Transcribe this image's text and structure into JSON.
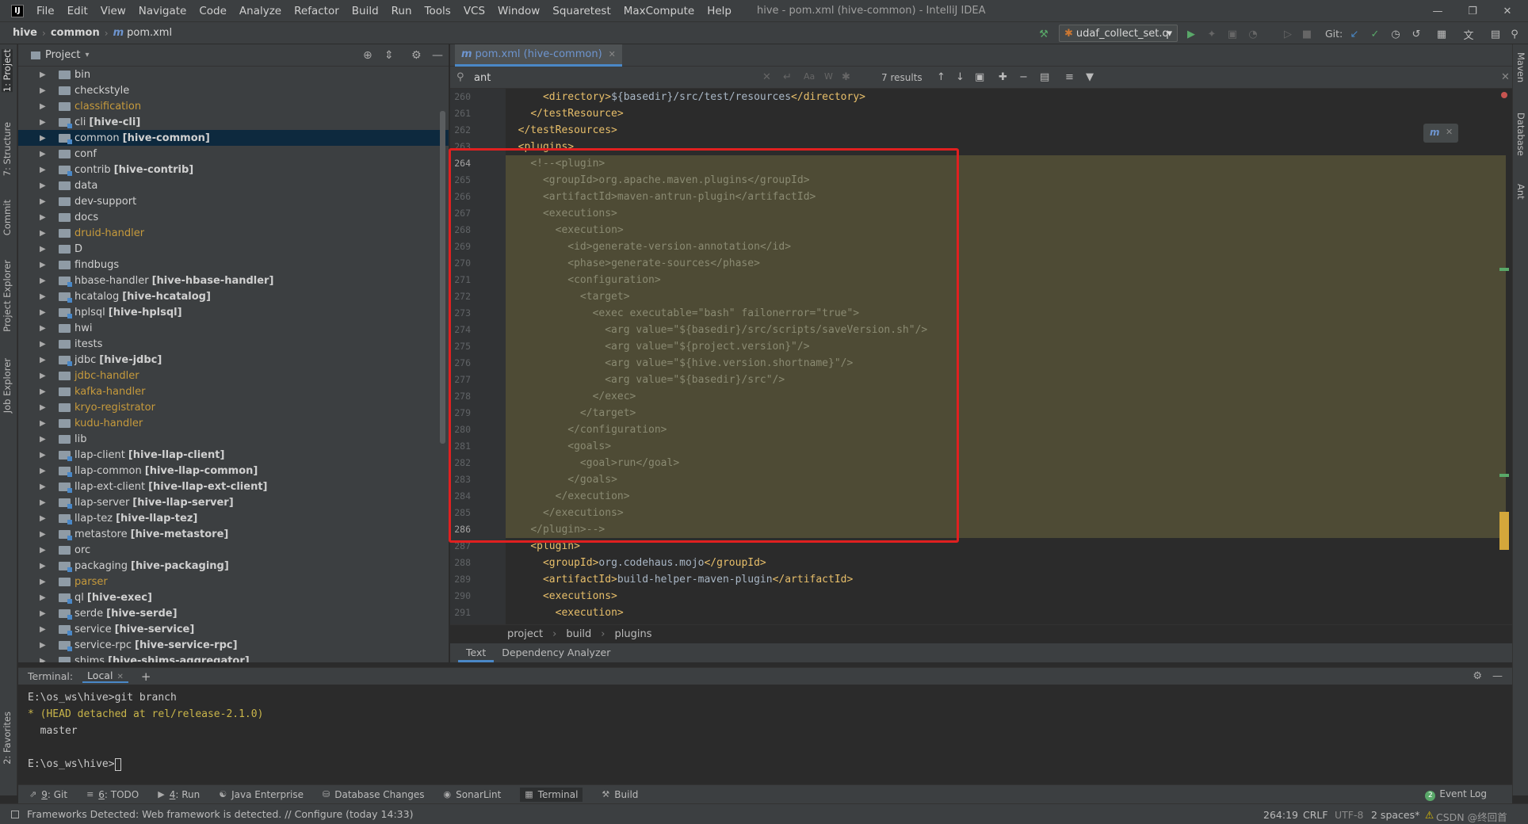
{
  "app": {
    "window_title": "hive - pom.xml (hive-common) - IntelliJ IDEA",
    "logo": "IJ",
    "menu": [
      "File",
      "Edit",
      "View",
      "Navigate",
      "Code",
      "Analyze",
      "Refactor",
      "Build",
      "Run",
      "Tools",
      "VCS",
      "Window",
      "Squaretest",
      "MaxCompute",
      "Help"
    ]
  },
  "navbar": {
    "crumbs": [
      "hive",
      "common",
      "pom.xml"
    ],
    "run_config": "udaf_collect_set.q",
    "git_label": "Git:"
  },
  "project_panel": {
    "title": "Project",
    "items": [
      {
        "name": "bin",
        "module": "",
        "style": "normal"
      },
      {
        "name": "checkstyle",
        "module": "",
        "style": "normal"
      },
      {
        "name": "classification",
        "module": "",
        "style": "orange"
      },
      {
        "name": "cli",
        "module": "[hive-cli]",
        "style": "normal"
      },
      {
        "name": "common",
        "module": "[hive-common]",
        "style": "selected"
      },
      {
        "name": "conf",
        "module": "",
        "style": "normal"
      },
      {
        "name": "contrib",
        "module": "[hive-contrib]",
        "style": "normal"
      },
      {
        "name": "data",
        "module": "",
        "style": "normal"
      },
      {
        "name": "dev-support",
        "module": "",
        "style": "normal"
      },
      {
        "name": "docs",
        "module": "",
        "style": "normal"
      },
      {
        "name": "druid-handler",
        "module": "",
        "style": "orange"
      },
      {
        "name": "D",
        "module": "",
        "style": "normal"
      },
      {
        "name": "findbugs",
        "module": "",
        "style": "normal"
      },
      {
        "name": "hbase-handler",
        "module": "[hive-hbase-handler]",
        "style": "normal"
      },
      {
        "name": "hcatalog",
        "module": "[hive-hcatalog]",
        "style": "normal"
      },
      {
        "name": "hplsql",
        "module": "[hive-hplsql]",
        "style": "normal"
      },
      {
        "name": "hwi",
        "module": "",
        "style": "normal"
      },
      {
        "name": "itests",
        "module": "",
        "style": "normal"
      },
      {
        "name": "jdbc",
        "module": "[hive-jdbc]",
        "style": "normal"
      },
      {
        "name": "jdbc-handler",
        "module": "",
        "style": "orange"
      },
      {
        "name": "kafka-handler",
        "module": "",
        "style": "orange"
      },
      {
        "name": "kryo-registrator",
        "module": "",
        "style": "orange"
      },
      {
        "name": "kudu-handler",
        "module": "",
        "style": "orange"
      },
      {
        "name": "lib",
        "module": "",
        "style": "normal"
      },
      {
        "name": "llap-client",
        "module": "[hive-llap-client]",
        "style": "normal"
      },
      {
        "name": "llap-common",
        "module": "[hive-llap-common]",
        "style": "normal"
      },
      {
        "name": "llap-ext-client",
        "module": "[hive-llap-ext-client]",
        "style": "normal"
      },
      {
        "name": "llap-server",
        "module": "[hive-llap-server]",
        "style": "normal"
      },
      {
        "name": "llap-tez",
        "module": "[hive-llap-tez]",
        "style": "normal"
      },
      {
        "name": "metastore",
        "module": "[hive-metastore]",
        "style": "normal"
      },
      {
        "name": "orc",
        "module": "",
        "style": "normal"
      },
      {
        "name": "packaging",
        "module": "[hive-packaging]",
        "style": "normal"
      },
      {
        "name": "parser",
        "module": "",
        "style": "orange"
      },
      {
        "name": "ql",
        "module": "[hive-exec]",
        "style": "normal"
      },
      {
        "name": "serde",
        "module": "[hive-serde]",
        "style": "normal"
      },
      {
        "name": "service",
        "module": "[hive-service]",
        "style": "normal"
      },
      {
        "name": "service-rpc",
        "module": "[hive-service-rpc]",
        "style": "normal"
      },
      {
        "name": "shims",
        "module": "[hive-shims-aggregator]",
        "style": "normal"
      }
    ]
  },
  "editor": {
    "tab_label": "pom.xml (hive-common)",
    "search_value": "ant",
    "search_results": "7 results",
    "lines": [
      {
        "n": "260",
        "hl": false,
        "indent": "      ",
        "parts": [
          [
            "tag",
            "<directory>"
          ],
          [
            "txt",
            "${basedir}/src/test/resources"
          ],
          [
            "tag",
            "</directory>"
          ]
        ]
      },
      {
        "n": "261",
        "hl": false,
        "indent": "    ",
        "parts": [
          [
            "tag",
            "</testResource>"
          ]
        ]
      },
      {
        "n": "262",
        "hl": false,
        "indent": "  ",
        "parts": [
          [
            "tag",
            "</testResources>"
          ]
        ]
      },
      {
        "n": "263",
        "hl": false,
        "indent": "  ",
        "parts": [
          [
            "tag",
            "<plugins>"
          ]
        ]
      },
      {
        "n": "264",
        "hl": true,
        "indent": "    ",
        "parts": [
          [
            "cmt",
            "<!--<plugin>"
          ]
        ]
      },
      {
        "n": "265",
        "hl": true,
        "indent": "      ",
        "parts": [
          [
            "cmt",
            "<groupId>org.apache.maven.plugins</groupId>"
          ]
        ]
      },
      {
        "n": "266",
        "hl": true,
        "indent": "      ",
        "parts": [
          [
            "cmt",
            "<artifactId>maven-antrun-plugin</artifactId>"
          ]
        ]
      },
      {
        "n": "267",
        "hl": true,
        "indent": "      ",
        "parts": [
          [
            "cmt",
            "<executions>"
          ]
        ]
      },
      {
        "n": "268",
        "hl": true,
        "indent": "        ",
        "parts": [
          [
            "cmt",
            "<execution>"
          ]
        ]
      },
      {
        "n": "269",
        "hl": true,
        "indent": "          ",
        "parts": [
          [
            "cmt",
            "<id>generate-version-annotation</id>"
          ]
        ]
      },
      {
        "n": "270",
        "hl": true,
        "indent": "          ",
        "parts": [
          [
            "cmt",
            "<phase>generate-sources</phase>"
          ]
        ]
      },
      {
        "n": "271",
        "hl": true,
        "indent": "          ",
        "parts": [
          [
            "cmt",
            "<configuration>"
          ]
        ]
      },
      {
        "n": "272",
        "hl": true,
        "indent": "            ",
        "parts": [
          [
            "cmt",
            "<target>"
          ]
        ]
      },
      {
        "n": "273",
        "hl": true,
        "indent": "              ",
        "parts": [
          [
            "cmt",
            "<exec executable=\"bash\" failonerror=\"true\">"
          ]
        ]
      },
      {
        "n": "274",
        "hl": true,
        "indent": "                ",
        "parts": [
          [
            "cmt",
            "<arg value=\"${basedir}/src/scripts/saveVersion.sh\"/>"
          ]
        ]
      },
      {
        "n": "275",
        "hl": true,
        "indent": "                ",
        "parts": [
          [
            "cmt",
            "<arg value=\"${project.version}\"/>"
          ]
        ]
      },
      {
        "n": "276",
        "hl": true,
        "indent": "                ",
        "parts": [
          [
            "cmt",
            "<arg value=\"${hive.version.shortname}\"/>"
          ]
        ]
      },
      {
        "n": "277",
        "hl": true,
        "indent": "                ",
        "parts": [
          [
            "cmt",
            "<arg value=\"${basedir}/src\"/>"
          ]
        ]
      },
      {
        "n": "278",
        "hl": true,
        "indent": "              ",
        "parts": [
          [
            "cmt",
            "</exec>"
          ]
        ]
      },
      {
        "n": "279",
        "hl": true,
        "indent": "            ",
        "parts": [
          [
            "cmt",
            "</target>"
          ]
        ]
      },
      {
        "n": "280",
        "hl": true,
        "indent": "          ",
        "parts": [
          [
            "cmt",
            "</configuration>"
          ]
        ]
      },
      {
        "n": "281",
        "hl": true,
        "indent": "          ",
        "parts": [
          [
            "cmt",
            "<goals>"
          ]
        ]
      },
      {
        "n": "282",
        "hl": true,
        "indent": "            ",
        "parts": [
          [
            "cmt",
            "<goal>run</goal>"
          ]
        ]
      },
      {
        "n": "283",
        "hl": true,
        "indent": "          ",
        "parts": [
          [
            "cmt",
            "</goals>"
          ]
        ]
      },
      {
        "n": "284",
        "hl": true,
        "indent": "        ",
        "parts": [
          [
            "cmt",
            "</execution>"
          ]
        ]
      },
      {
        "n": "285",
        "hl": true,
        "indent": "      ",
        "parts": [
          [
            "cmt",
            "</executions>"
          ]
        ]
      },
      {
        "n": "286",
        "hl": true,
        "indent": "    ",
        "parts": [
          [
            "cmt",
            "</plugin>-->"
          ]
        ]
      },
      {
        "n": "287",
        "hl": false,
        "indent": "    ",
        "parts": [
          [
            "tag",
            "<plugin>"
          ]
        ]
      },
      {
        "n": "288",
        "hl": false,
        "indent": "      ",
        "parts": [
          [
            "tag",
            "<groupId>"
          ],
          [
            "txt",
            "org.codehaus.mojo"
          ],
          [
            "tag",
            "</groupId>"
          ]
        ]
      },
      {
        "n": "289",
        "hl": false,
        "indent": "      ",
        "parts": [
          [
            "tag",
            "<artifactId>"
          ],
          [
            "txt",
            "build-helper-maven-plugin"
          ],
          [
            "tag",
            "</artifactId>"
          ]
        ]
      },
      {
        "n": "290",
        "hl": false,
        "indent": "      ",
        "parts": [
          [
            "tag",
            "<executions>"
          ]
        ]
      },
      {
        "n": "291",
        "hl": false,
        "indent": "        ",
        "parts": [
          [
            "tag",
            "<execution>"
          ]
        ]
      }
    ],
    "breadcrumbs": [
      "project",
      "build",
      "plugins"
    ],
    "bottom_tabs": [
      "Text",
      "Dependency Analyzer"
    ]
  },
  "terminal": {
    "label": "Terminal:",
    "tab": "Local",
    "lines": [
      {
        "text": "E:\\os_ws\\hive>git branch",
        "style": "normal"
      },
      {
        "text": "* (HEAD detached at rel/release-2.1.0)",
        "style": "yellow"
      },
      {
        "text": "  master",
        "style": "normal"
      },
      {
        "text": "",
        "style": "normal"
      },
      {
        "text": "E:\\os_ws\\hive>",
        "style": "prompt"
      }
    ]
  },
  "tool_windows": [
    {
      "num": "9",
      "label": "Git",
      "icon": "git-icon"
    },
    {
      "num": "6",
      "label": "TODO",
      "icon": "todo-icon"
    },
    {
      "num": "4",
      "label": "Run",
      "icon": "run-icon"
    },
    {
      "num": "",
      "label": "Java Enterprise",
      "icon": "java-enterprise-icon"
    },
    {
      "num": "",
      "label": "Database Changes",
      "icon": "database-icon"
    },
    {
      "num": "",
      "label": "SonarLint",
      "icon": "sonarlint-icon"
    },
    {
      "num": "",
      "label": "Terminal",
      "icon": "terminal-icon"
    },
    {
      "num": "",
      "label": "Build",
      "icon": "build-icon"
    }
  ],
  "event_log": "Event Log",
  "event_log_count": "2",
  "status": {
    "message": "Frameworks Detected: Web framework is detected. // Configure (today 14:33)",
    "position": "264:19",
    "line_sep": "CRLF",
    "encoding": "UTF-8",
    "indent": "2 spaces*",
    "watermark": "CSDN @终回首"
  },
  "left_tabs": [
    "1: Project",
    "7: Structure",
    "Commit",
    "Project Explorer",
    "Job Explorer",
    "2: Favorites"
  ],
  "right_tabs": [
    "Maven",
    "Database",
    "Ant"
  ]
}
